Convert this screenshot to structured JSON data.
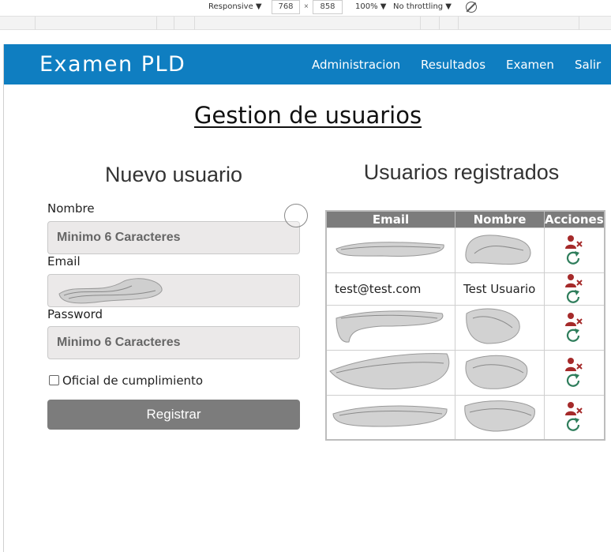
{
  "devtools": {
    "device_mode": "Responsive ▼",
    "width": "768",
    "times": "×",
    "height": "858",
    "zoom": "100% ▼",
    "throttling": "No throttling ▼"
  },
  "navbar": {
    "brand": "Examen PLD",
    "links": [
      "Administracion",
      "Resultados",
      "Examen",
      "Salir"
    ]
  },
  "page_title": "Gestion de usuarios",
  "new_user": {
    "title": "Nuevo usuario",
    "name_label": "Nombre",
    "name_placeholder": "Minimo 6 Caracteres",
    "email_label": "Email",
    "password_label": "Password",
    "password_placeholder": "Minimo 6 Caracteres",
    "compliance_label": "Oficial de cumplimiento",
    "submit_label": "Registrar"
  },
  "registered": {
    "title": "Usuarios registrados",
    "columns": [
      "Email",
      "Nombre",
      "Acciones"
    ],
    "rows": [
      {
        "email": "",
        "name": ""
      },
      {
        "email": "test@test.com",
        "name": "Test Usuario"
      },
      {
        "email": "",
        "name": ""
      },
      {
        "email": "",
        "name": ""
      },
      {
        "email": "",
        "name": ""
      }
    ]
  },
  "colors": {
    "navbar": "#0f7ec1",
    "delete_icon": "#a52a2a",
    "refresh_icon": "#2e7d5b",
    "button": "#7c7c7c"
  },
  "icons": {
    "delete_user": "user-x-icon",
    "reset": "refresh-icon"
  }
}
